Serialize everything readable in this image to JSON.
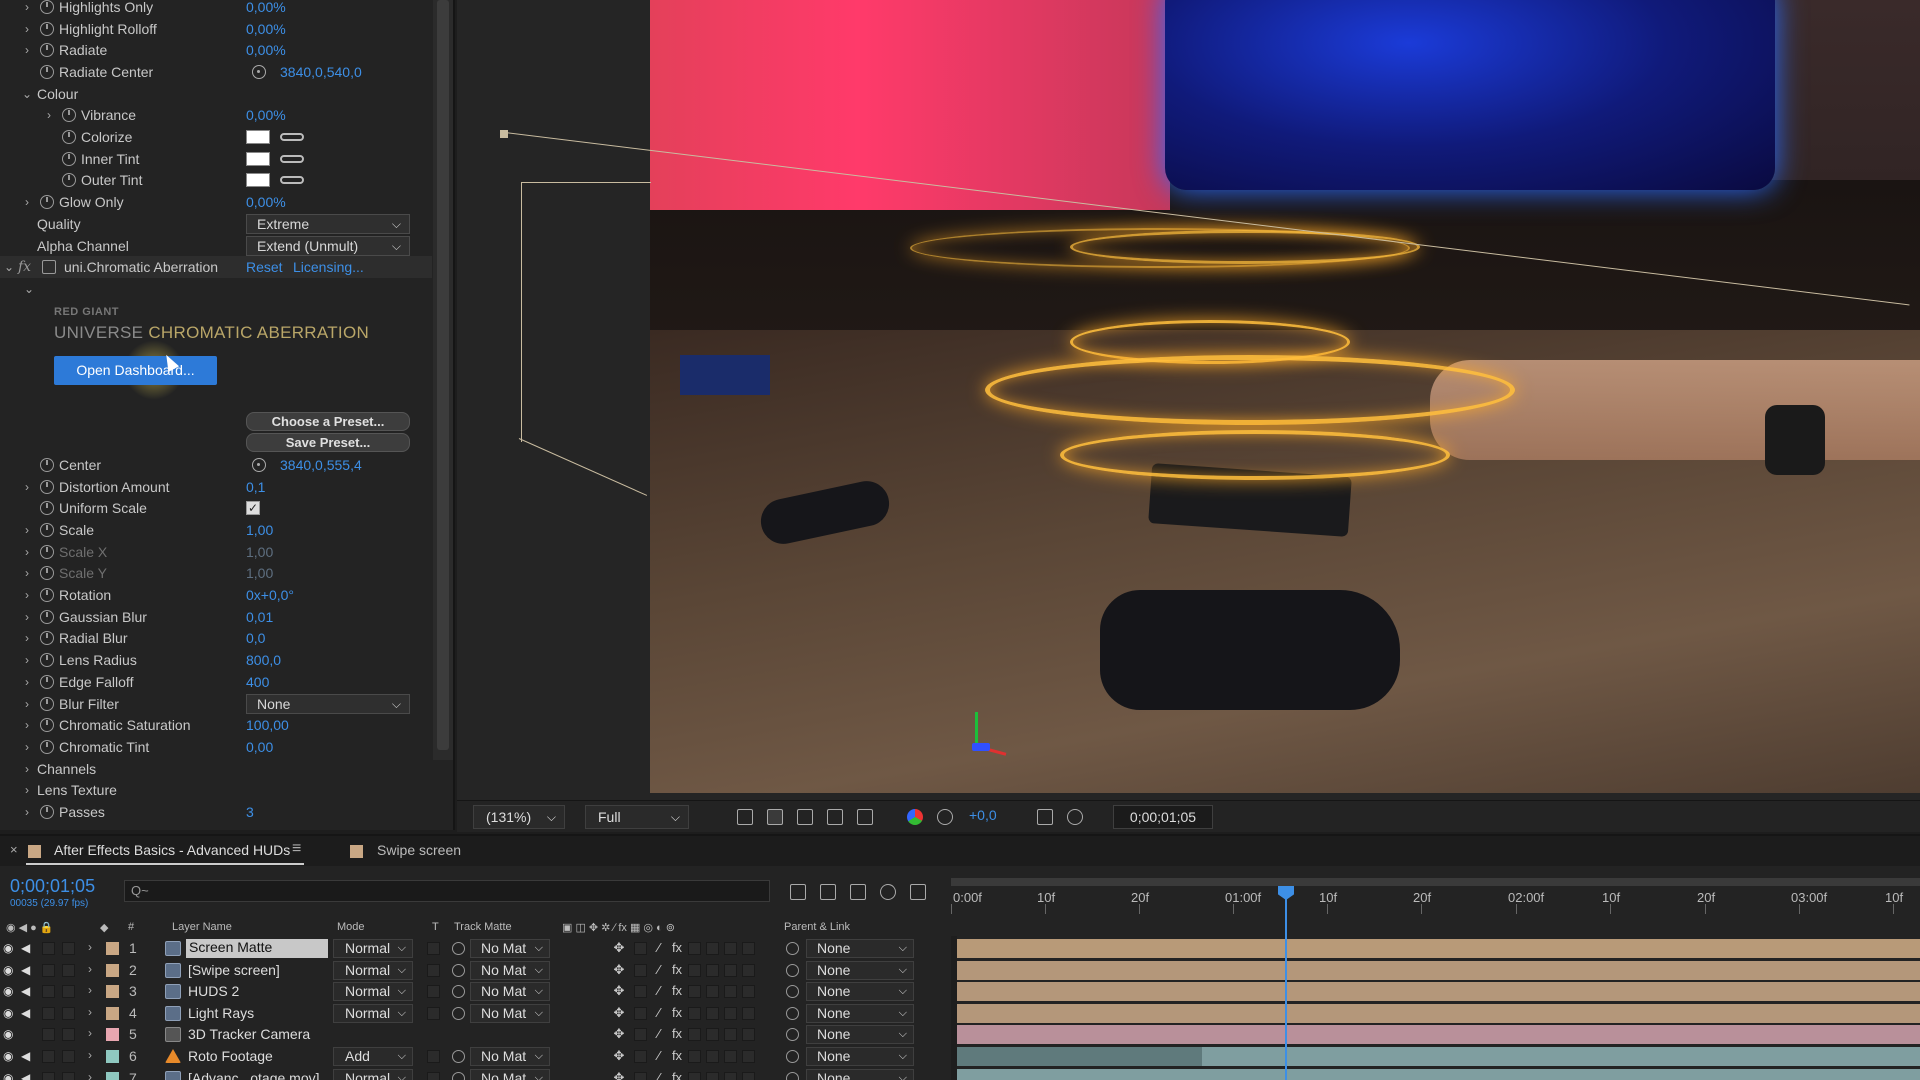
{
  "effect_controls": {
    "rows": [
      {
        "name": "Highlights Only",
        "value": "0,00%",
        "type": "value",
        "twirl": true,
        "stopwatch": true
      },
      {
        "name": "Highlight Rolloff",
        "value": "0,00%",
        "type": "value",
        "twirl": true,
        "stopwatch": true
      },
      {
        "name": "Radiate",
        "value": "0,00%",
        "type": "value",
        "twirl": true,
        "stopwatch": true
      },
      {
        "name": "Radiate Center",
        "value": "3840,0,540,0",
        "type": "point",
        "twirl": false,
        "stopwatch": true
      },
      {
        "name": "Colour",
        "value": "",
        "type": "group",
        "twirl": true,
        "stopwatch": false
      },
      {
        "name": "Vibrance",
        "value": "0,00%",
        "type": "value",
        "twirl": true,
        "stopwatch": true,
        "indent": 1
      },
      {
        "name": "Colorize",
        "value": "",
        "type": "color",
        "twirl": false,
        "stopwatch": true,
        "indent": 1
      },
      {
        "name": "Inner Tint",
        "value": "",
        "type": "color",
        "twirl": false,
        "stopwatch": true,
        "indent": 1
      },
      {
        "name": "Outer Tint",
        "value": "",
        "type": "color",
        "twirl": false,
        "stopwatch": true,
        "indent": 1
      },
      {
        "name": "Glow Only",
        "value": "0,00%",
        "type": "value",
        "twirl": true,
        "stopwatch": true
      },
      {
        "name": "Quality",
        "value": "Extreme",
        "type": "dropdown",
        "twirl": false,
        "stopwatch": false
      },
      {
        "name": "Alpha Channel",
        "value": "Extend (Unmult)",
        "type": "dropdown",
        "twirl": false,
        "stopwatch": false
      }
    ],
    "effect": {
      "name": "uni.Chromatic Aberration",
      "reset": "Reset",
      "licensing": "Licensing..."
    },
    "brand": "RED GIANT",
    "brand_title_a": "UNIVERSE ",
    "brand_title_b": "CHROMATIC ABERRATION",
    "open_dashboard": "Open Dashboard...",
    "choose_preset": "Choose a Preset...",
    "save_preset": "Save Preset...",
    "rows2": [
      {
        "name": "Center",
        "value": "3840,0,555,4",
        "type": "point",
        "twirl": false,
        "stopwatch": true
      },
      {
        "name": "Distortion Amount",
        "value": "0,1",
        "type": "value",
        "twirl": true,
        "stopwatch": true
      },
      {
        "name": "Uniform Scale",
        "value": "",
        "type": "checkbox",
        "twirl": false,
        "stopwatch": true
      },
      {
        "name": "Scale",
        "value": "1,00",
        "type": "value",
        "twirl": true,
        "stopwatch": true
      },
      {
        "name": "Scale X",
        "value": "1,00",
        "type": "value",
        "twirl": true,
        "stopwatch": true,
        "dim": true
      },
      {
        "name": "Scale Y",
        "value": "1,00",
        "type": "value",
        "twirl": true,
        "stopwatch": true,
        "dim": true
      },
      {
        "name": "Rotation",
        "value": "0x+0,0°",
        "type": "value",
        "twirl": true,
        "stopwatch": true
      },
      {
        "name": "Gaussian Blur",
        "value": "0,01",
        "type": "value",
        "twirl": true,
        "stopwatch": true
      },
      {
        "name": "Radial Blur",
        "value": "0,0",
        "type": "value",
        "twirl": true,
        "stopwatch": true
      },
      {
        "name": "Lens Radius",
        "value": "800,0",
        "type": "value",
        "twirl": true,
        "stopwatch": true
      },
      {
        "name": "Edge Falloff",
        "value": "400",
        "type": "value",
        "twirl": true,
        "stopwatch": true
      },
      {
        "name": "Blur Filter",
        "value": "None",
        "type": "dropdown",
        "twirl": true,
        "stopwatch": true
      },
      {
        "name": "Chromatic Saturation",
        "value": "100,00",
        "type": "value",
        "twirl": true,
        "stopwatch": true
      },
      {
        "name": "Chromatic Tint",
        "value": "0,00",
        "type": "value",
        "twirl": true,
        "stopwatch": true
      },
      {
        "name": "Channels",
        "value": "",
        "type": "group",
        "twirl": true,
        "stopwatch": false
      },
      {
        "name": "Lens Texture",
        "value": "",
        "type": "group",
        "twirl": true,
        "stopwatch": false
      },
      {
        "name": "Passes",
        "value": "3",
        "type": "value",
        "twirl": true,
        "stopwatch": true
      }
    ]
  },
  "viewer_toolbar": {
    "zoom": "(131%)",
    "resolution": "Full",
    "exposure": "+0,0",
    "timecode": "0;00;01;05"
  },
  "timeline": {
    "tabs": [
      {
        "label": "After Effects Basics - Advanced HUDs",
        "active": true,
        "color": "#c9a784"
      },
      {
        "label": "Swipe screen",
        "active": false,
        "color": "#c9a784"
      }
    ],
    "timecode": "0;00;01;05",
    "timecode_sub": "00035 (29.97 fps)",
    "search_placeholder": "Q~",
    "ruler": [
      "0:00f",
      "10f",
      "20f",
      "01:00f",
      "10f",
      "20f",
      "02:00f",
      "10f",
      "20f",
      "03:00f",
      "10f"
    ],
    "columns": {
      "layer_name": "Layer Name",
      "mode": "Mode",
      "t": "T",
      "track_matte": "Track Matte",
      "parent": "Parent & Link"
    },
    "layers": [
      {
        "num": "1",
        "name": "Screen Matte",
        "mode": "Normal",
        "matte": "No Mat",
        "parent": "None",
        "label": "#c9a784",
        "selected": true,
        "bar": "#b89a78"
      },
      {
        "num": "2",
        "name": "[Swipe screen]",
        "mode": "Normal",
        "matte": "No Mat",
        "parent": "None",
        "label": "#c9a784",
        "selected": false,
        "bar": "#b4977a"
      },
      {
        "num": "3",
        "name": "HUDS 2",
        "mode": "Normal",
        "matte": "No Mat",
        "parent": "None",
        "label": "#c9a784",
        "selected": false,
        "bar": "#b4977a"
      },
      {
        "num": "4",
        "name": "Light Rays",
        "mode": "Normal",
        "matte": "No Mat",
        "parent": "None",
        "label": "#c9a784",
        "selected": false,
        "bar": "#b4977a"
      },
      {
        "num": "5",
        "name": "3D Tracker Camera",
        "mode": "",
        "matte": "",
        "parent": "None",
        "label": "#e8a6b0",
        "selected": false,
        "bar": "#b9909a"
      },
      {
        "num": "6",
        "name": "Roto Footage",
        "mode": "Add",
        "matte": "No Mat",
        "parent": "None",
        "label": "#8fc8c0",
        "selected": false,
        "bar": "#7f9ea0"
      },
      {
        "num": "7",
        "name": "[Advanc...otage.mov]",
        "mode": "Normal",
        "matte": "No Mat",
        "parent": "None",
        "label": "#8fc8c0",
        "selected": false,
        "bar": "#7f9ea0"
      }
    ]
  }
}
